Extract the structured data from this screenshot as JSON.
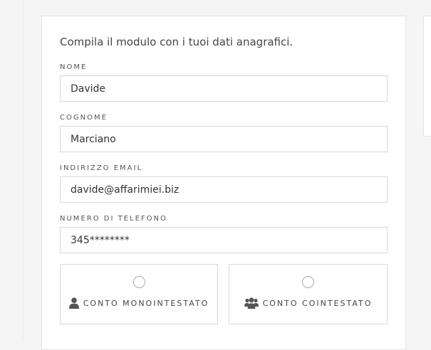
{
  "form": {
    "intro": "Compila il modulo con i tuoi dati anagrafici.",
    "fields": [
      {
        "label": "NOME",
        "value": "Davide"
      },
      {
        "label": "COGNOME",
        "value": "Marciano"
      },
      {
        "label": "INDIRIZZO EMAIL",
        "value": "davide@affarimiei.biz"
      },
      {
        "label": "NUMERO DI TELEFONO",
        "value": "345********"
      }
    ],
    "options": [
      {
        "label": "CONTO MONOINTESTATO",
        "icon": "user-icon",
        "selected": false
      },
      {
        "label": "CONTO COINTESTATO",
        "icon": "users-icon",
        "selected": false
      }
    ]
  },
  "colors": {
    "border": "#d8d8d8",
    "icon": "#555555",
    "text": "#333333"
  }
}
